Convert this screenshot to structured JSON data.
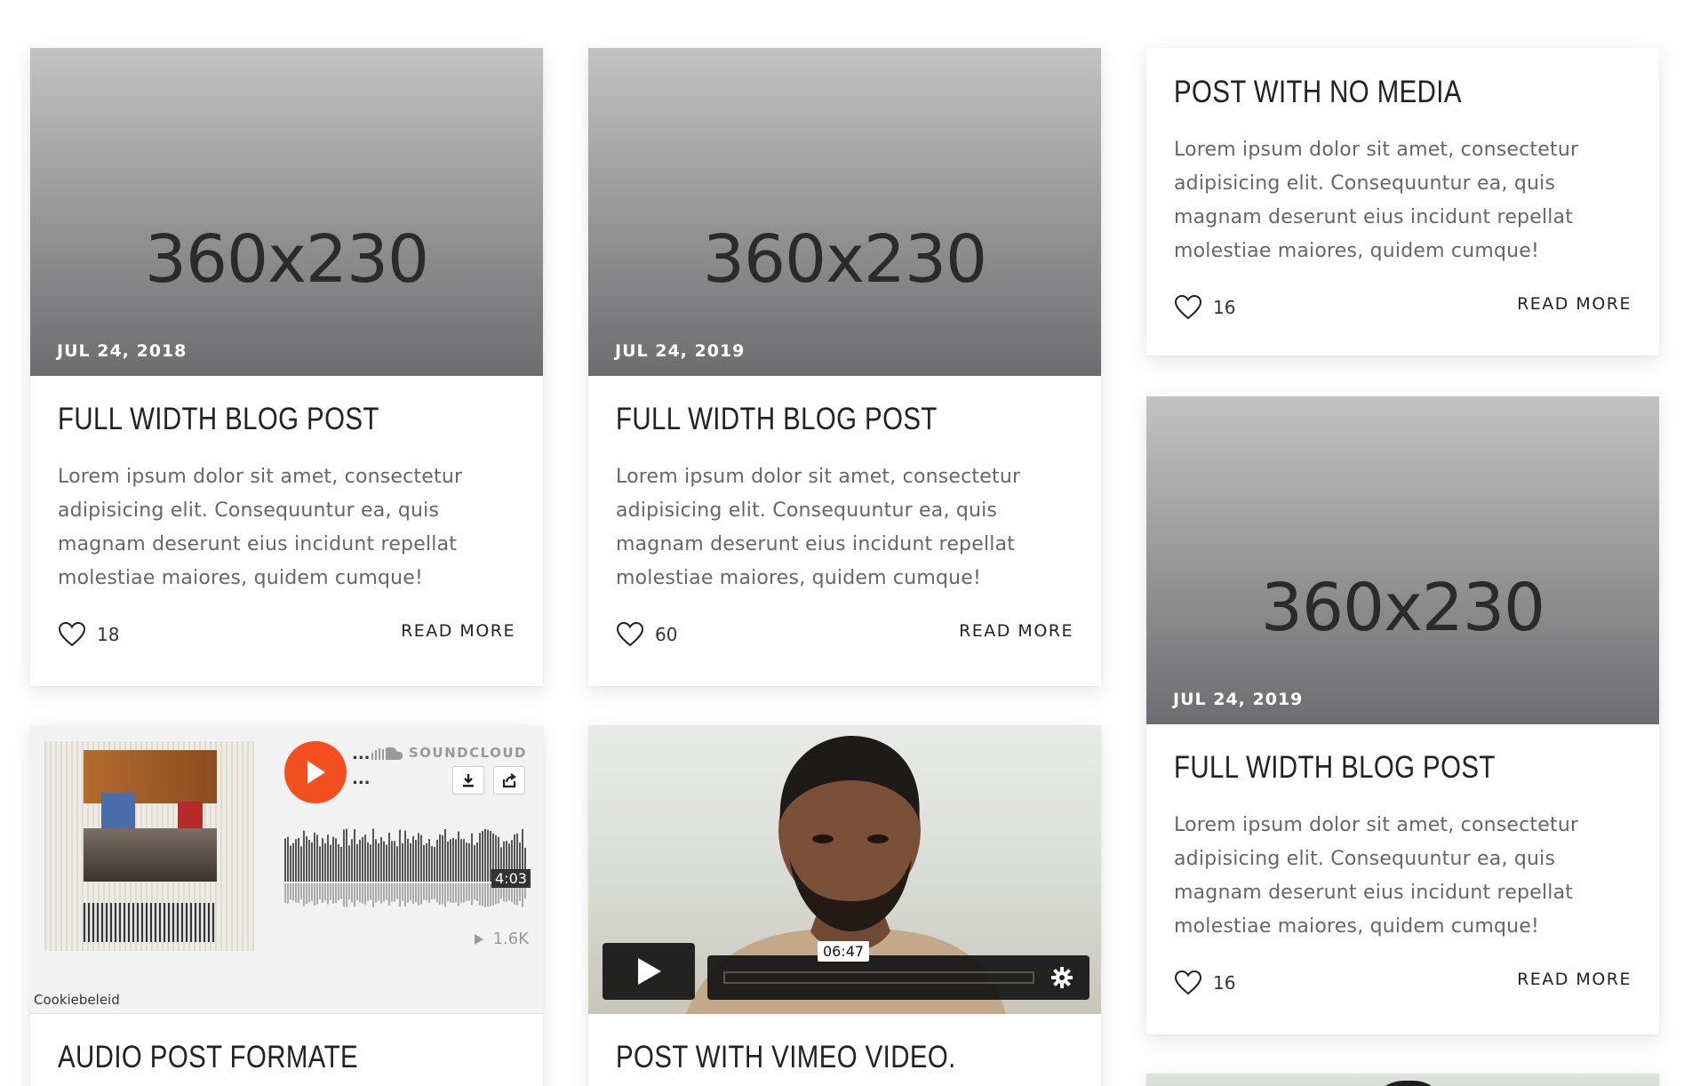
{
  "colors": {
    "read_more": "#222222",
    "date": "#ffffff",
    "soundcloud": "#f24e1e",
    "placeholder_text": "#2b2b2b"
  },
  "cards": [
    {
      "placeholder": "360x230",
      "date": "JUL 24, 2018",
      "title": "FULL WIDTH BLOG POST",
      "excerpt": "Lorem ipsum dolor sit amet, consectetur adipisicing elit. Consequuntur ea, quis magnam deserunt eius incidunt repellat molestiae maiores, quidem cumque!",
      "likes": "18",
      "read_more": "READ MORE"
    },
    {
      "placeholder": "360x230",
      "date": "JUL 24, 2019",
      "title": "FULL WIDTH BLOG POST",
      "excerpt": "Lorem ipsum dolor sit amet, consectetur adipisicing elit. Consequuntur ea, quis magnam deserunt eius incidunt repellat molestiae maiores, quidem cumque!",
      "likes": "60",
      "read_more": "READ MORE"
    },
    {
      "title": "POST WITH NO MEDIA",
      "excerpt": "Lorem ipsum dolor sit amet, consectetur adipisicing elit. Consequuntur ea, quis magnam deserunt eius incidunt repellat molestiae maiores, quidem cumque!",
      "likes": "16",
      "read_more": "READ MORE"
    },
    {
      "placeholder": "360x230",
      "date": "JUL 24, 2019",
      "title": "FULL WIDTH BLOG POST",
      "excerpt": "Lorem ipsum dolor sit amet, consectetur adipisicing elit. Consequuntur ea, quis magnam deserunt eius incidunt repellat molestiae maiores, quidem cumque!",
      "likes": "16",
      "read_more": "READ MORE"
    },
    {
      "title": "AUDIO POST FORMATE",
      "soundcloud": {
        "brand": "SOUNDCLOUD",
        "dots_top": "...",
        "dots_bottom": "...",
        "duration": "4:03",
        "plays": "1.6K",
        "cookie": "Cookiebeleid",
        "icons": [
          "play-icon",
          "download-icon",
          "share-icon",
          "soundcloud-logo-icon"
        ]
      }
    },
    {
      "title": "POST WITH VIMEO VIDEO.",
      "vimeo": {
        "timestamp": "06:47",
        "icons": [
          "play-icon",
          "gear-icon"
        ]
      }
    }
  ]
}
